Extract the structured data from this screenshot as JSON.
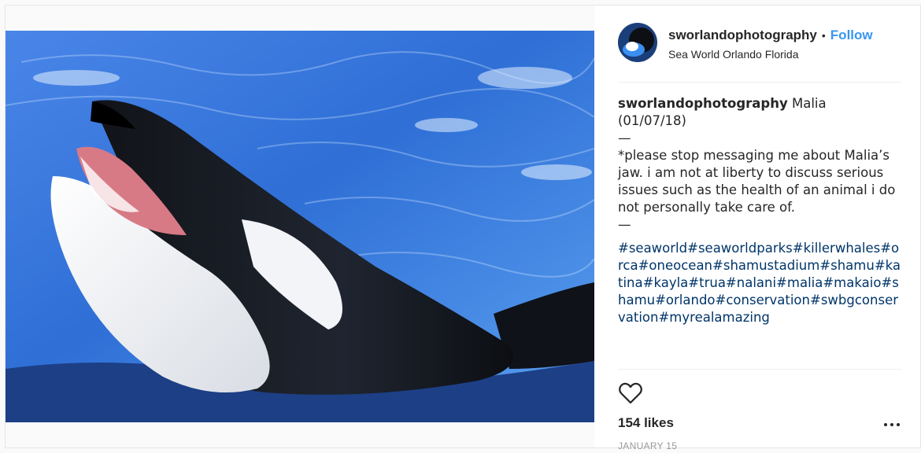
{
  "post": {
    "username": "sworlandophotography",
    "separator": "•",
    "follow_label": "Follow",
    "location": "Sea World Orlando Florida",
    "caption_title": "Malia",
    "caption_date": "(01/07/18)",
    "divider": "—",
    "caption_body": "*please stop messaging me about Malia’s jaw. i am not at liberty to discuss serious issues such as the health of an animal i do not personally take care of.",
    "hashtags": "#seaworld#seaworldparks#killerwhales#orca#oneocean#shamustadium#shamu#katina#kayla#trua#nalani#malia#makaio#shamu#orlando#conservation#swbgconservation#myrealamazing",
    "likes": "154 likes",
    "date": "JANUARY 15"
  },
  "icons": {
    "like": "heart-outline-icon",
    "options": "more-horizontal-icon"
  },
  "colors": {
    "follow": "#3897f0",
    "hashtag": "#003569",
    "text": "#262626",
    "muted": "#999999",
    "water": "#3d7fe0"
  }
}
